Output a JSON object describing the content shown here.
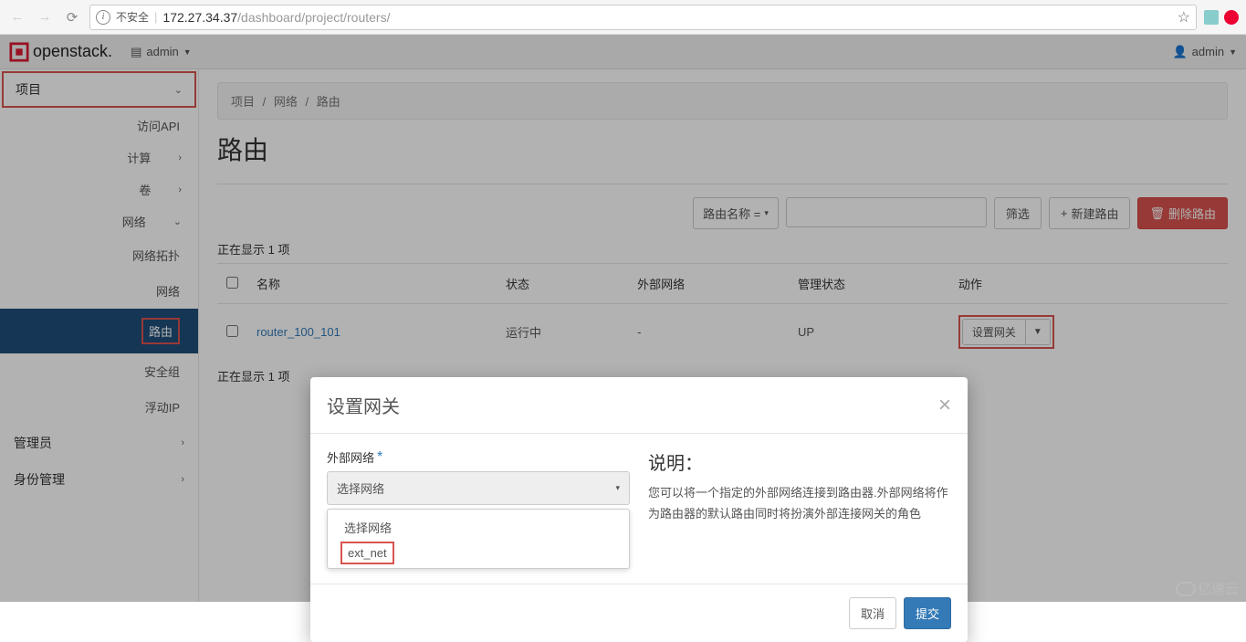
{
  "browser": {
    "url_insecure": "不安全",
    "url_host": "172.27.34.37",
    "url_path": "/dashboard/project/routers/"
  },
  "topbar": {
    "brand": "openstack.",
    "project": "admin",
    "user": "admin"
  },
  "sidebar": {
    "project": "项目",
    "access_api": "访问API",
    "compute": "计算",
    "volume": "卷",
    "network": "网络",
    "net_topology": "网络拓扑",
    "net_networks": "网络",
    "net_routers": "路由",
    "net_secgroups": "安全组",
    "net_floatingips": "浮动IP",
    "admin": "管理员",
    "identity": "身份管理"
  },
  "breadcrumb": {
    "project": "项目",
    "network": "网络",
    "routers": "路由",
    "sep": "/"
  },
  "page": {
    "title": "路由",
    "count_top": "正在显示 1 项",
    "count_bottom": "正在显示 1 项"
  },
  "toolbar": {
    "filter_label": "路由名称 =",
    "filter_btn": "筛选",
    "create_btn": "新建路由",
    "delete_btn": "删除路由"
  },
  "table": {
    "headers": {
      "name": "名称",
      "status": "状态",
      "ext_network": "外部网络",
      "admin_state": "管理状态",
      "actions": "动作"
    },
    "rows": [
      {
        "name": "router_100_101",
        "status": "运行中",
        "ext_network": "-",
        "admin_state": "UP",
        "action": "设置网关"
      }
    ]
  },
  "modal": {
    "title": "设置网关",
    "field_label": "外部网络",
    "select_placeholder": "选择网络",
    "options": {
      "placeholder": "选择网络",
      "ext_net": "ext_net"
    },
    "desc_title": "说明：",
    "desc_text": "您可以将一个指定的外部网络连接到路由器.外部网络将作为路由器的默认路由同时将扮演外部连接网关的角色",
    "cancel": "取消",
    "submit": "提交"
  },
  "watermark": "亿速云"
}
